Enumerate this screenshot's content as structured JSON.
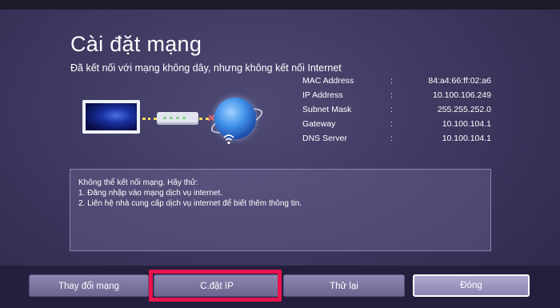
{
  "dialog": {
    "title": "Cài đặt mạng",
    "subtitle": "Đã kết nối với mạng không dây, nhưng không kết nối Internet"
  },
  "network_info": [
    {
      "label": "MAC Address",
      "value": "84:a4:66:ff:02:a6"
    },
    {
      "label": "IP Address",
      "value": "10.100.106.249"
    },
    {
      "label": "Subnet Mask",
      "value": "255.255.252.0"
    },
    {
      "label": "Gateway",
      "value": "10.100.104.1"
    },
    {
      "label": "DNS Server",
      "value": "10.100.104.1"
    }
  ],
  "separator": ":",
  "message": {
    "lines": [
      "Không thể kết nối mạng. Hãy thử:",
      "1. Đăng nhập vào mạng dịch vụ internet.",
      "2. Liên hệ nhà cung cấp dịch vụ internet để biết thêm thông tin."
    ]
  },
  "buttons": {
    "change_network": "Thay đổi mạng",
    "ip_settings": "C.đặt IP",
    "retry": "Thử lại",
    "close": "Đóng"
  },
  "icons": {
    "tv": "tv-icon",
    "router": "router-icon",
    "disconnect": "disconnect-x-icon",
    "internet": "globe-icon",
    "wifi": "wifi-icon"
  },
  "colors": {
    "highlight": "#e8144e",
    "link": "#f2dc60",
    "error": "#f05a5a"
  }
}
